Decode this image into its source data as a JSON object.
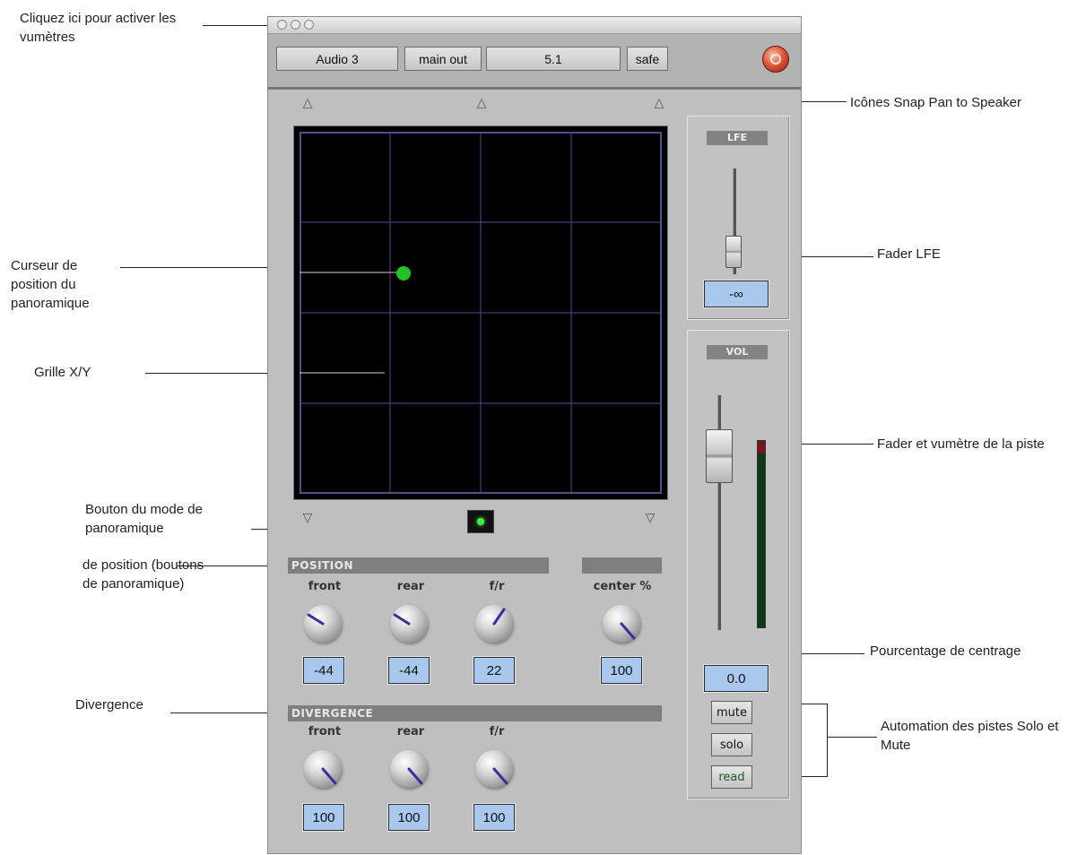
{
  "annotations": {
    "meter_activate": "Cliquez ici pour activer les vumètres",
    "snap_icons": "Icônes Snap Pan to Speaker",
    "cursor": "Curseur de position du panoramique",
    "lfe_fader": "Fader LFE",
    "xy_grid": "Grille X/Y",
    "track_fader": "Fader et vumètre de la piste",
    "pan_mode": "Bouton du mode de panoramique",
    "position_knobs": "de position (boutons de panoramique)",
    "center_pct": "Pourcentage de centrage",
    "divergence": "Divergence",
    "automation": "Automation des pistes Solo et Mute"
  },
  "header": {
    "track_name": "Audio 3",
    "output": "main out",
    "format": "5.1",
    "safe": "safe"
  },
  "position": {
    "title": "POSITION",
    "knobs": [
      {
        "label": "front",
        "value": "-44"
      },
      {
        "label": "rear",
        "value": "-44"
      },
      {
        "label": "f/r",
        "value": "22"
      }
    ],
    "center": {
      "label": "center %",
      "value": "100"
    }
  },
  "divergence": {
    "title": "DIVERGENCE",
    "knobs": [
      {
        "label": "front",
        "value": "100"
      },
      {
        "label": "rear",
        "value": "100"
      },
      {
        "label": "f/r",
        "value": "100"
      }
    ]
  },
  "lfe": {
    "title": "LFE",
    "value": "-∞"
  },
  "vol": {
    "title": "VOL",
    "value": "0.0"
  },
  "buttons": {
    "mute": "mute",
    "solo": "solo",
    "read": "read"
  },
  "colors": {
    "grid_line": "#4b4f8a",
    "cursor": "#22c322",
    "value_box": "#a8c8ee"
  }
}
